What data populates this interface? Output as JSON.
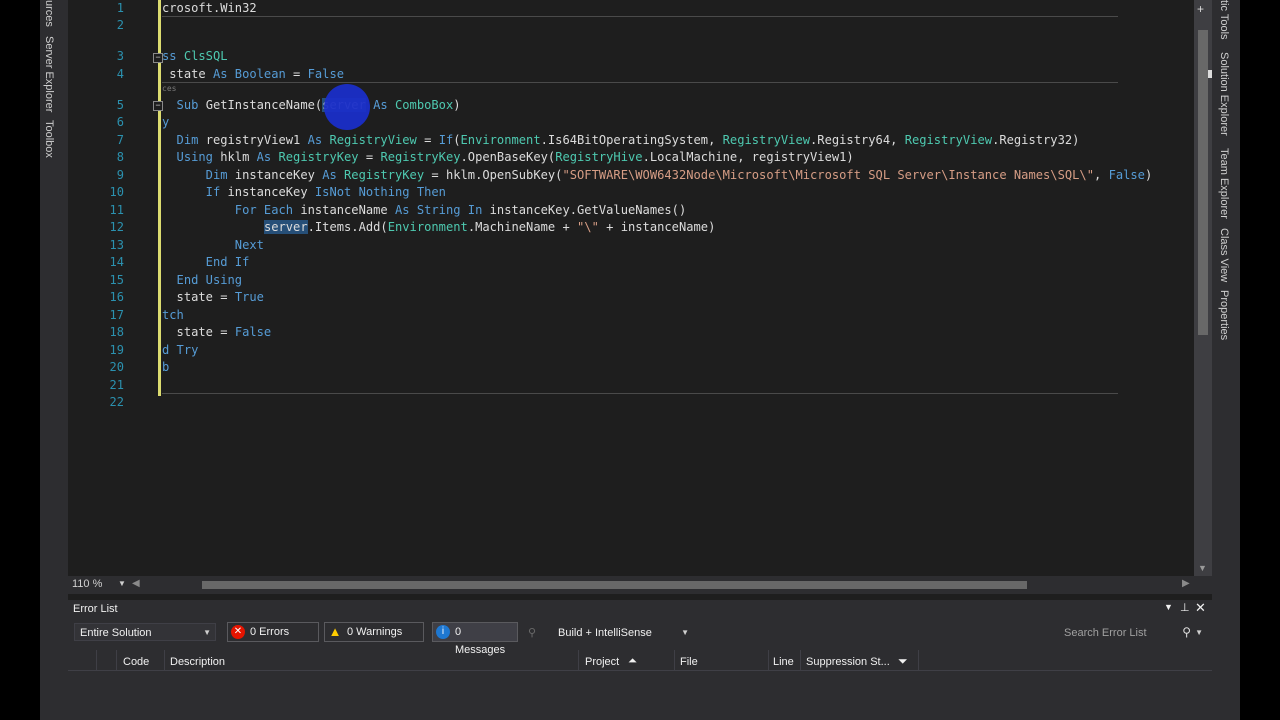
{
  "left_strip": {
    "items": [
      "urces",
      "Server Explorer",
      "Toolbox"
    ]
  },
  "right_strip": {
    "items": [
      "tic Tools",
      "Solution Explorer",
      "Team Explorer",
      "Class View",
      "Properties"
    ]
  },
  "editor": {
    "line_numbers": [
      "1",
      "2",
      "3",
      "4",
      "5",
      "6",
      "7",
      "8",
      "9",
      "10",
      "11",
      "12",
      "13",
      "14",
      "15",
      "16",
      "17",
      "18",
      "19",
      "20",
      "21",
      "22"
    ],
    "codelens_hint": "ces"
  },
  "status": {
    "zoom": "110 %"
  },
  "error_list": {
    "title": "Error List",
    "scope": "Entire Solution",
    "errors": "0 Errors",
    "warnings": "0 Warnings",
    "messages": "0 Messages",
    "source": "Build + IntelliSense",
    "search_placeholder": "Search Error List",
    "columns": {
      "code": "Code",
      "description": "Description",
      "project": "Project",
      "file": "File",
      "line": "Line",
      "suppression": "Suppression St..."
    }
  },
  "colors": {
    "keyword": "#569cd6",
    "type": "#4ec9b0",
    "string": "#d69d85",
    "line_number": "#2b91af",
    "change_bar": "#dcdc70"
  }
}
